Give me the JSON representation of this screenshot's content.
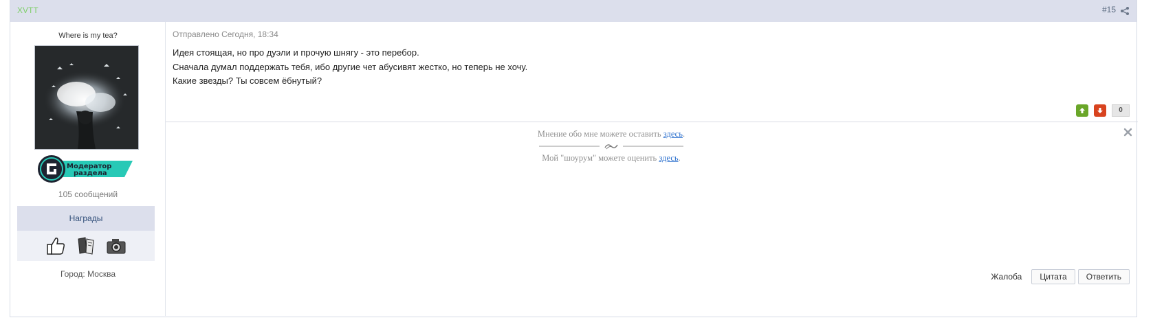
{
  "post": {
    "author": "XVTT",
    "number": "#15",
    "share_icon": "share-icon"
  },
  "sidebar": {
    "user_title": "Where is my tea?",
    "badge_text_1": "Модератор",
    "badge_text_2": "раздела",
    "post_count": "105 сообщений",
    "awards_label": "Награды",
    "award_icons": [
      "thumbs-up-icon",
      "book-icon",
      "camera-icon"
    ],
    "city_label": "Город:",
    "city_value": "Москва"
  },
  "content": {
    "date": "Отправлено Сегодня, 18:34",
    "body_lines": [
      "Идея стоящая, но про дуэли и прочую шнягу - это перебор.",
      "Сначала думал поддержать тебя, ибо другие чет абусивят жестко, но теперь не хочу.",
      "Какие звезды? Ты совсем ёбнутый?"
    ],
    "rating": "0"
  },
  "signature": {
    "line1_text": "Мнение обо мне можете оставить ",
    "line1_link": "здесь",
    "line1_end": ".",
    "line2_text": "Мой \"шоурум\" можете оценить ",
    "line2_link": "здесь",
    "line2_end": "."
  },
  "actions": {
    "complaint": "Жалоба",
    "quote": "Цитата",
    "reply": "Ответить"
  },
  "colors": {
    "header_bg": "#dcdfec",
    "author": "#7fcf6a",
    "vote_up": "#6aa629",
    "vote_down": "#d8431f",
    "link": "#2a6fce"
  }
}
